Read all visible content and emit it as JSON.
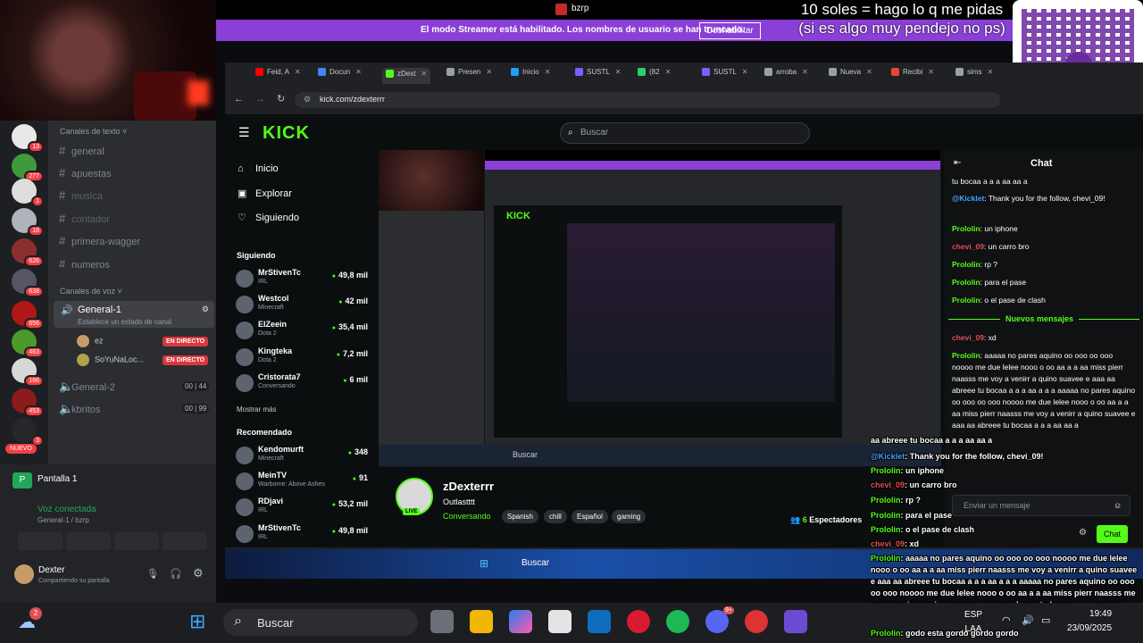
{
  "top": {
    "app_title": "bzrp",
    "streamer_notice": "El modo Streamer está habilitado. Los nombres de usuario se han truncado.",
    "streamer_button": "Deshabilitar",
    "overlay_line1": "10 soles = hago lo q me pidas",
    "overlay_line2": "(si es algo muy pendejo no ps)",
    "qr_label": "yape"
  },
  "discord": {
    "servers": [
      {
        "badge": "13"
      },
      {
        "badge": "277"
      },
      {
        "badge": "1"
      },
      {
        "badge": "18"
      },
      {
        "badge": "626"
      },
      {
        "badge": "638"
      },
      {
        "badge": "656"
      },
      {
        "badge": "463"
      },
      {
        "badge": "166"
      },
      {
        "badge": "453"
      },
      {
        "badge": "3"
      }
    ],
    "new_badge": "NUEVO",
    "text_category": "Canales de texto",
    "text_channels": [
      "general",
      "apuestas",
      "musica",
      "contador",
      "primera-wagger",
      "numeros"
    ],
    "voice_category": "Canales de voz",
    "voice_channel": {
      "name": "General-1",
      "status": "Establece un estado de canal"
    },
    "voice_users": [
      {
        "name": "ez",
        "live": "EN DIRECTO"
      },
      {
        "name": "SoYuNaLoc...",
        "live": "EN DIRECTO"
      }
    ],
    "other_voice": [
      {
        "name": "General-2",
        "c1": "00",
        "c2": "44"
      },
      {
        "name": "kbritos",
        "c1": "00",
        "c2": "99"
      }
    ],
    "screen_share": "Pantalla 1",
    "voice_status": "Voz conectada",
    "voice_location": "General-1 / bzrp",
    "user_name": "Dexter",
    "user_status": "Compartiendo su pantalla"
  },
  "browser": {
    "tabs": [
      {
        "label": "Feid, A",
        "color": "#ff0000"
      },
      {
        "label": "Docun",
        "color": "#4285f4"
      },
      {
        "label": "zDext",
        "color": "#53fc18"
      },
      {
        "label": "Presen",
        "color": "#9aa0a6"
      },
      {
        "label": "Inicio",
        "color": "#1da1f2"
      },
      {
        "label": "SUSTL",
        "color": "#7b61ff"
      },
      {
        "label": "(82",
        "color": "#25d366"
      },
      {
        "label": "SUSTL",
        "color": "#7b61ff"
      },
      {
        "label": "arroba",
        "color": "#9aa0a6"
      },
      {
        "label": "Nueva",
        "color": "#9aa0a6"
      },
      {
        "label": "Recibi",
        "color": "#ea4335"
      },
      {
        "label": "sims",
        "color": "#9aa0a6"
      }
    ],
    "url": "kick.com/zdexterrr"
  },
  "kick": {
    "logo": "KICK",
    "search_placeholder": "Buscar",
    "nav": [
      "Inicio",
      "Explorar",
      "Siguiendo"
    ],
    "following_title": "Siguiendo",
    "following": [
      {
        "name": "MrStivenTc",
        "cat": "IRL",
        "viewers": "49,8 mil"
      },
      {
        "name": "Westcol",
        "cat": "Minecraft",
        "viewers": "42 mil"
      },
      {
        "name": "ElZeein",
        "cat": "Dota 2",
        "viewers": "35,4 mil"
      },
      {
        "name": "Kingteka",
        "cat": "Dota 2",
        "viewers": "7,2 mil"
      },
      {
        "name": "Cristorata7",
        "cat": "Conversando",
        "viewers": "6 mil"
      }
    ],
    "show_more": "Mostrar más",
    "recommended_title": "Recomendado",
    "recommended": [
      {
        "name": "Kendomurft",
        "cat": "Minecraft",
        "viewers": "348"
      },
      {
        "name": "MeinTV",
        "cat": "Warborne: Above Ashes",
        "viewers": "91"
      },
      {
        "name": "RDjavi",
        "cat": "IRL",
        "viewers": "53,2 mil"
      },
      {
        "name": "MrStivenTc",
        "cat": "IRL",
        "viewers": "49,8 mil"
      }
    ],
    "stream": {
      "name": "zDexterrr",
      "live": "LIVE",
      "title": "Outlastttt",
      "category": "Conversando",
      "tags": [
        "Spanish",
        "chill",
        "Español",
        "gaming"
      ],
      "viewers_count": "6",
      "viewers_label": "Espectadores"
    },
    "chat": {
      "title": "Chat",
      "messages_top": [
        {
          "user": "",
          "text": "tu bocaa a a a aa aa a"
        },
        {
          "user": "@Kicklet",
          "text": ": Thank you for the follow, chevi_09!"
        },
        {
          "user": "Prololin",
          "text": ": un iphone"
        },
        {
          "user": "chevi_09",
          "text": ": un carro bro"
        },
        {
          "user": "Prololin",
          "text": ": rp ?"
        },
        {
          "user": "Prololin",
          "text": ": para el pase"
        },
        {
          "user": "Prololin",
          "text": ": o el pase de clash"
        }
      ],
      "new_messages": "Nuevos mensajes",
      "messages_bottom": [
        {
          "user": "chevi_09",
          "text": ": xd"
        },
        {
          "user": "Prololin",
          "text": ": aaaaa no pares aquino oo ooo oo ooo noooo me due lelee nooo o oo aa a a aa miss pierr naasss me voy a venirr a quino suavee e aaa aa abreee tu bocaa a a a aa a a a aaaaa no pares aquino oo ooo oo ooo noooo me due lelee nooo o oo aa a a aa miss pierr naasss me voy a venirr a quino suavee e aaa aa abreee tu bocaa a a a aa aa a"
        }
      ],
      "input_placeholder": "Enviar un mensaje",
      "send": "Chat"
    }
  },
  "overlay_chat": [
    {
      "user": "",
      "text": "aa abreee tu bocaa a a a aa aa a"
    },
    {
      "user": "@Kicklet",
      "text": ": Thank you for the follow, chevi_09!"
    },
    {
      "user": "Prololin",
      "text": ": un iphone"
    },
    {
      "user": "chevi_09",
      "text": ": un carro bro"
    },
    {
      "user": "Prololin",
      "text": ": rp ?"
    },
    {
      "user": "Prololin",
      "text": ": para el pase"
    },
    {
      "user": "Prololin",
      "text": ": o el pase de clash"
    },
    {
      "user": "chevi_09",
      "text": ": xd"
    },
    {
      "user": "Prololin",
      "text": ": aaaaa no pares aquino oo ooo oo ooo noooo me due lelee nooo o oo aa a a aa miss pierr naasss me voy a venirr a quino suavee e aaa aa abreee tu bocaa a a a aa a a a aaaaa no pares aquino oo ooo oo ooo noooo me due lelee nooo o oo aa a a aa miss pierr naasss me voy a venirr a quino suavee e aaa aa abreee tu bocaa a a a aa aa a"
    },
    {
      "user": "Prololin",
      "text": ": godo esta gordo gordo gordo"
    }
  ],
  "nested_taskbar_search": "Buscar",
  "taskbar": {
    "search": "Buscar",
    "weather_badge": "2",
    "lang1": "ESP",
    "lang2": "LAA",
    "time": "19:49",
    "date": "23/09/2025",
    "discord_badge": "9+"
  }
}
